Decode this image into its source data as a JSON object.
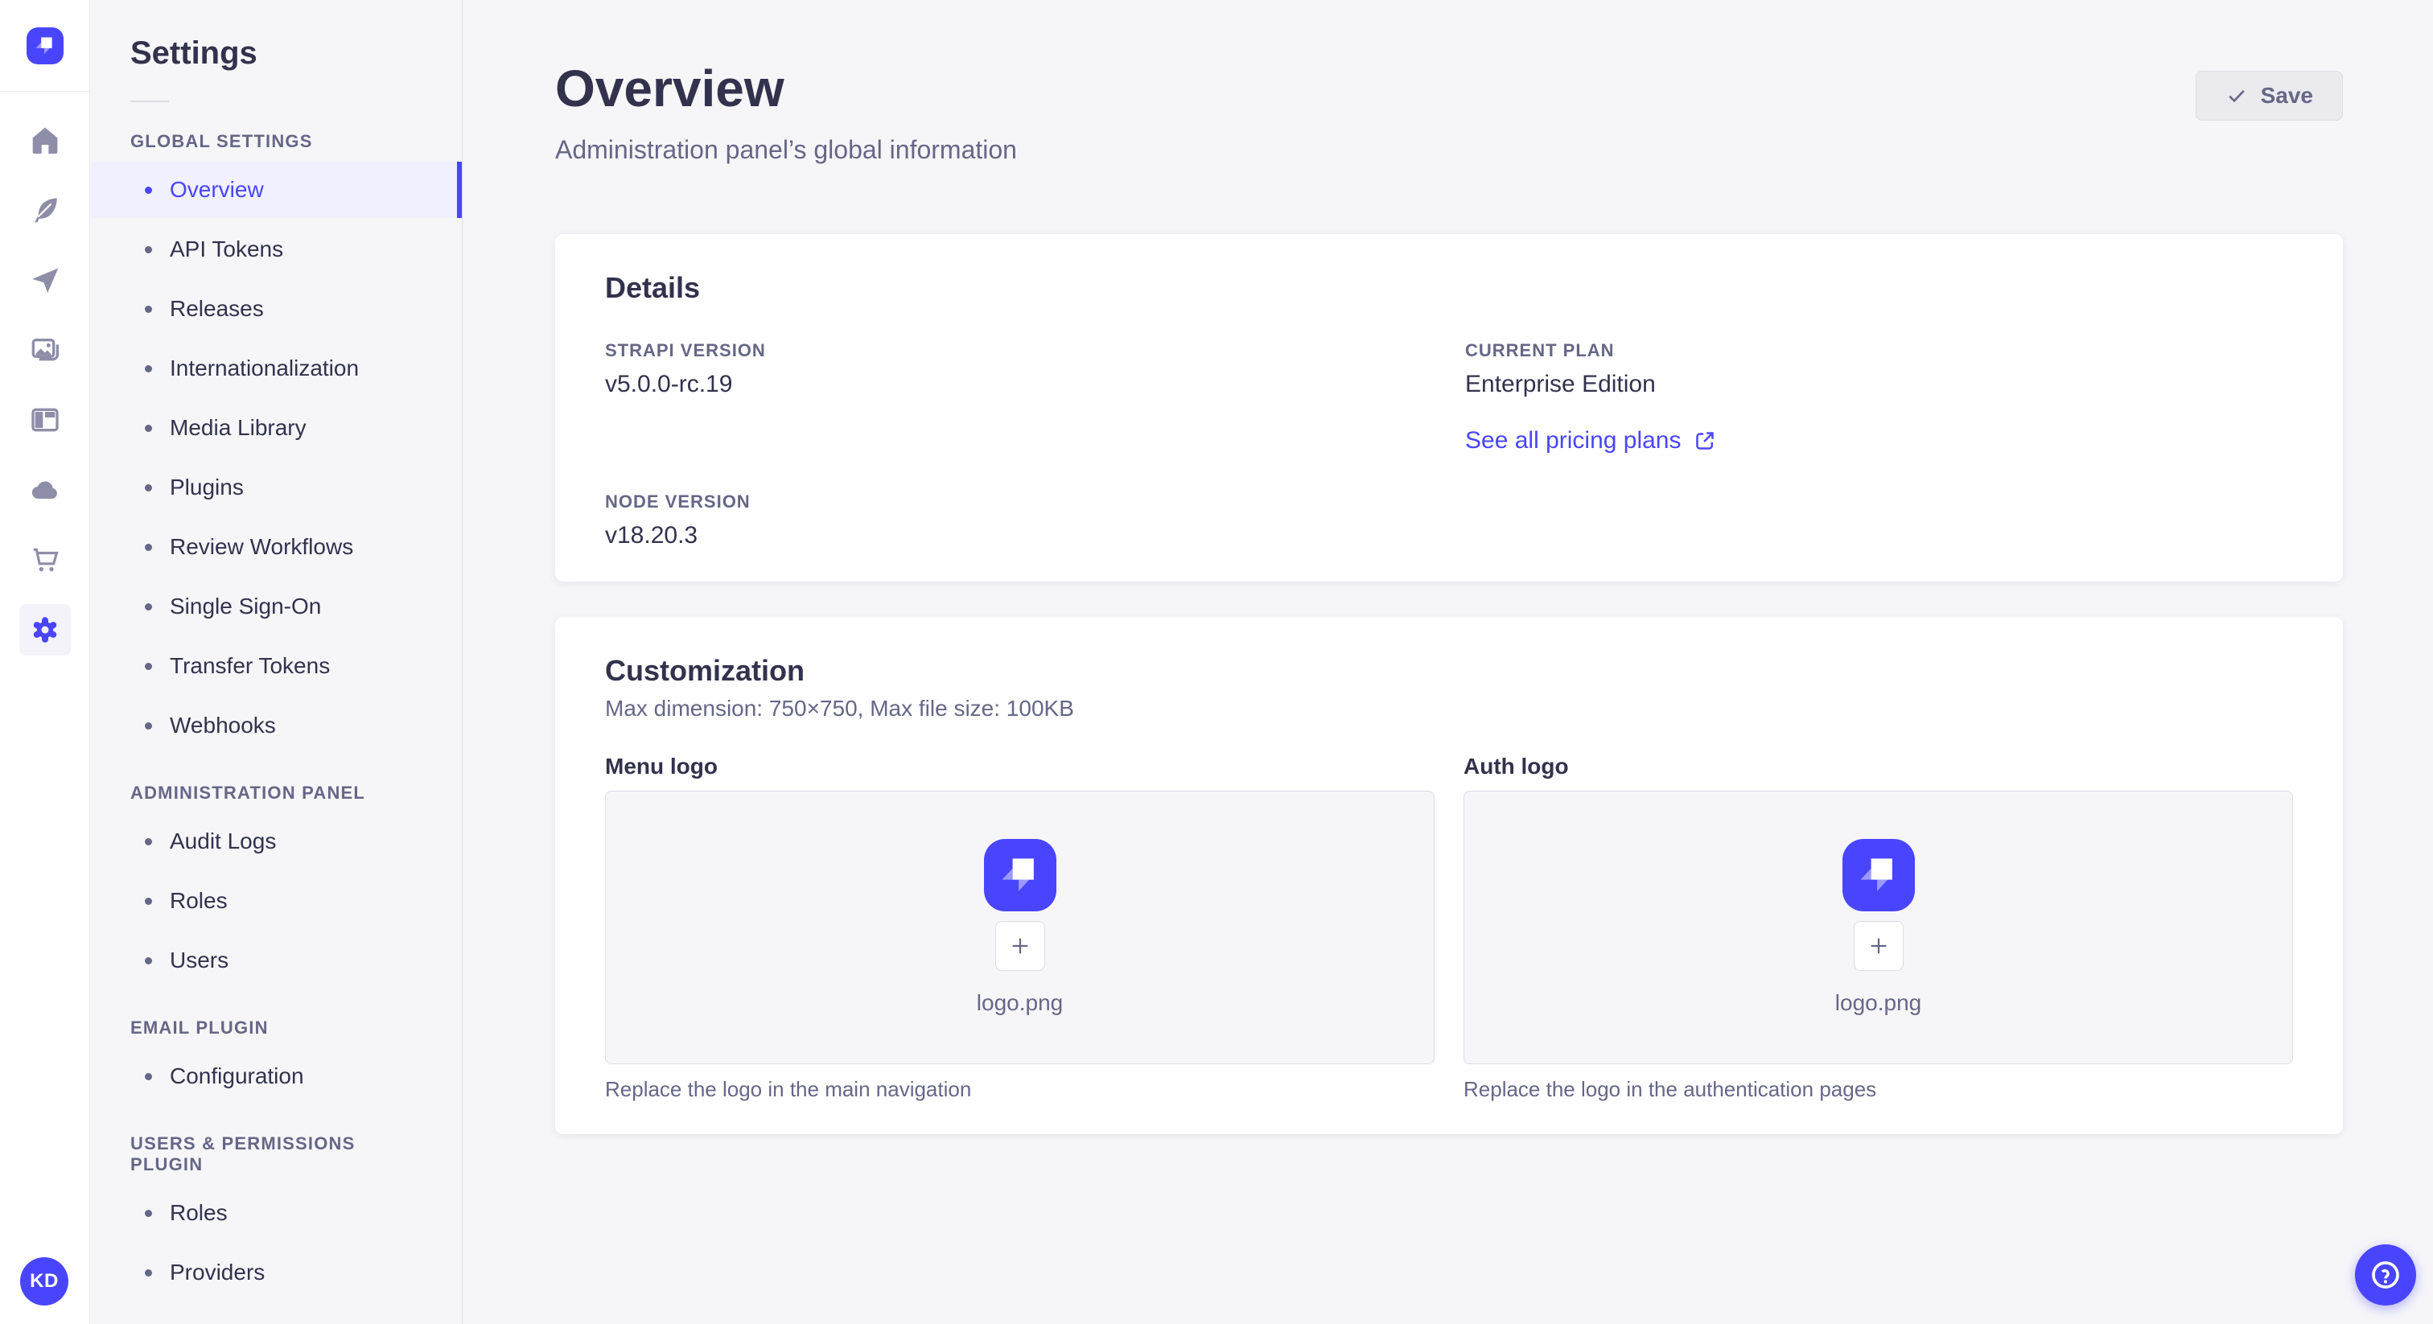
{
  "app": {
    "accent_color": "#4945FF",
    "active_bg_color": "#F0F0FF"
  },
  "icon_rail": {
    "logo_icon": "strapi-logo",
    "icons": [
      "home-icon",
      "feather-icon",
      "paper-plane-icon",
      "media-gallery-icon",
      "layout-icon",
      "cloud-icon",
      "cart-icon",
      "gear-icon"
    ],
    "active_icon": "gear-icon",
    "user_initials": "KD"
  },
  "settings_nav": {
    "title": "Settings",
    "sections": [
      {
        "heading": "GLOBAL SETTINGS",
        "items": [
          {
            "label": "Overview"
          },
          {
            "label": "API Tokens"
          },
          {
            "label": "Releases"
          },
          {
            "label": "Internationalization"
          },
          {
            "label": "Media Library"
          },
          {
            "label": "Plugins"
          },
          {
            "label": "Review Workflows"
          },
          {
            "label": "Single Sign-On"
          },
          {
            "label": "Transfer Tokens"
          },
          {
            "label": "Webhooks"
          }
        ]
      },
      {
        "heading": "ADMINISTRATION PANEL",
        "items": [
          {
            "label": "Audit Logs"
          },
          {
            "label": "Roles"
          },
          {
            "label": "Users"
          }
        ]
      },
      {
        "heading": "EMAIL PLUGIN",
        "items": [
          {
            "label": "Configuration"
          }
        ]
      },
      {
        "heading": "USERS & PERMISSIONS PLUGIN",
        "items": [
          {
            "label": "Roles"
          },
          {
            "label": "Providers"
          }
        ]
      }
    ]
  },
  "header": {
    "title": "Overview",
    "subtitle": "Administration panel’s global information",
    "save_label": "Save"
  },
  "details": {
    "title": "Details",
    "strapi_version_label": "STRAPI VERSION",
    "strapi_version": "v5.0.0-rc.19",
    "current_plan_label": "CURRENT PLAN",
    "current_plan": "Enterprise Edition",
    "pricing_link_label": "See all pricing plans",
    "node_version_label": "NODE VERSION",
    "node_version": "v18.20.3"
  },
  "customization": {
    "title": "Customization",
    "subtitle": "Max dimension: 750×750, Max file size: 100KB",
    "menu_logo_label": "Menu logo",
    "auth_logo_label": "Auth logo",
    "filename": "logo.png",
    "menu_caption": "Replace the logo in the main navigation",
    "auth_caption": "Replace the logo in the authentication pages"
  },
  "help": {
    "icon": "question-mark-icon"
  }
}
